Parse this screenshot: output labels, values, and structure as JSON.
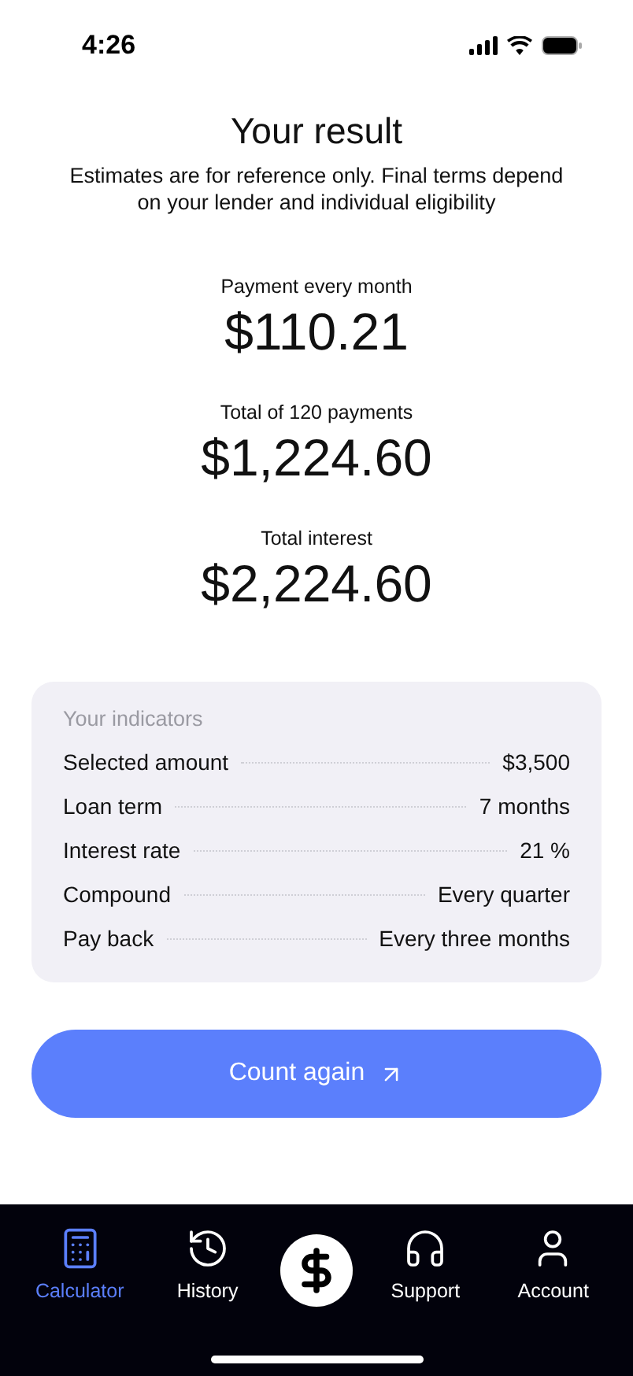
{
  "status_bar": {
    "time": "4:26"
  },
  "header": {
    "title": "Your result",
    "subtitle": "Estimates are for reference only. Final terms depend on your lender and individual eligibility"
  },
  "metrics": [
    {
      "label": "Payment every month",
      "value": "$110.21"
    },
    {
      "label": "Total of 120 payments",
      "value": "$1,224.60"
    },
    {
      "label": "Total interest",
      "value": "$2,224.60"
    }
  ],
  "indicators": {
    "title": "Your indicators",
    "rows": [
      {
        "label": "Selected amount",
        "value": "$3,500"
      },
      {
        "label": "Loan term",
        "value": "7 months"
      },
      {
        "label": "Interest rate",
        "value": "21 %"
      },
      {
        "label": "Compound",
        "value": "Every quarter"
      },
      {
        "label": "Pay back",
        "value": "Every three months"
      }
    ]
  },
  "action_button": {
    "label": "Count again"
  },
  "tab_bar": [
    {
      "kind": "calculator",
      "label": "Calculator",
      "selected": true
    },
    {
      "kind": "history",
      "label": "History",
      "selected": false
    },
    {
      "kind": "center",
      "selected": false
    },
    {
      "kind": "support",
      "label": "Support",
      "selected": false
    },
    {
      "kind": "account",
      "label": "Account",
      "selected": false
    }
  ]
}
